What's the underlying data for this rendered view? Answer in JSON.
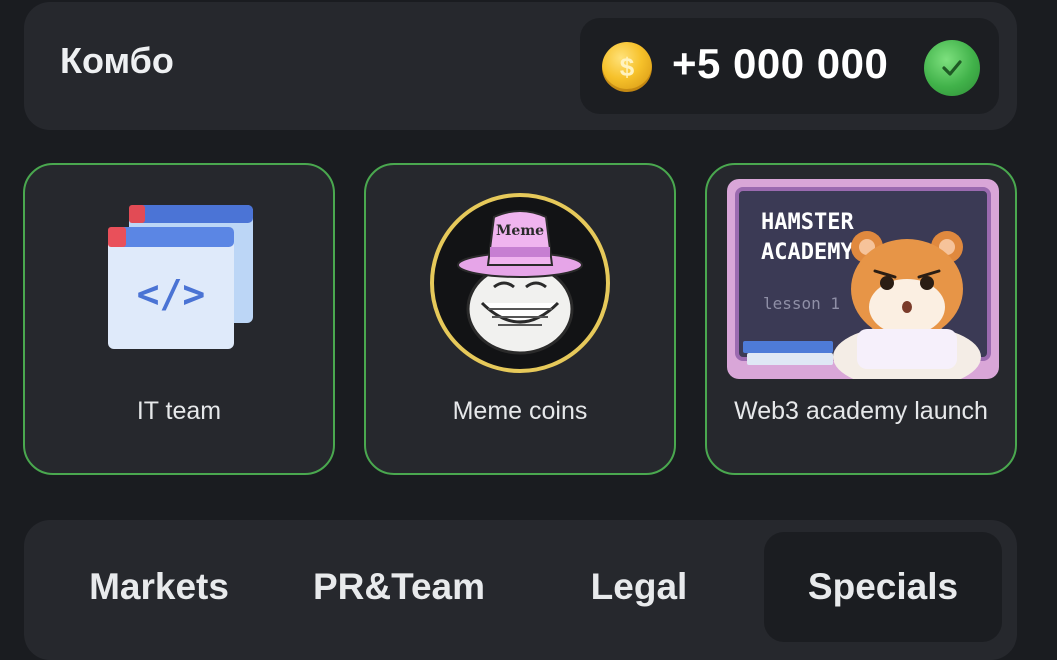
{
  "combo": {
    "title": "Комбо",
    "reward_amount": "+5 000 000",
    "coin_icon": "coin-icon",
    "status_icon": "check-icon",
    "accent_color": "#4aa84f"
  },
  "cards": [
    {
      "label": "IT team",
      "icon": "code-window-icon"
    },
    {
      "label": "Meme coins",
      "icon": "meme-hat-icon",
      "hat_text": "Meme"
    },
    {
      "label": "Web3 academy launch",
      "icon": "hamster-academy-image",
      "board_title_1": "HAMSTER",
      "board_title_2": "ACADEMY",
      "board_subtitle": "lesson 1"
    }
  ],
  "tabs": [
    {
      "label": "Markets",
      "active": false
    },
    {
      "label": "PR&Team",
      "active": false
    },
    {
      "label": "Legal",
      "active": false
    },
    {
      "label": "Specials",
      "active": true
    }
  ]
}
